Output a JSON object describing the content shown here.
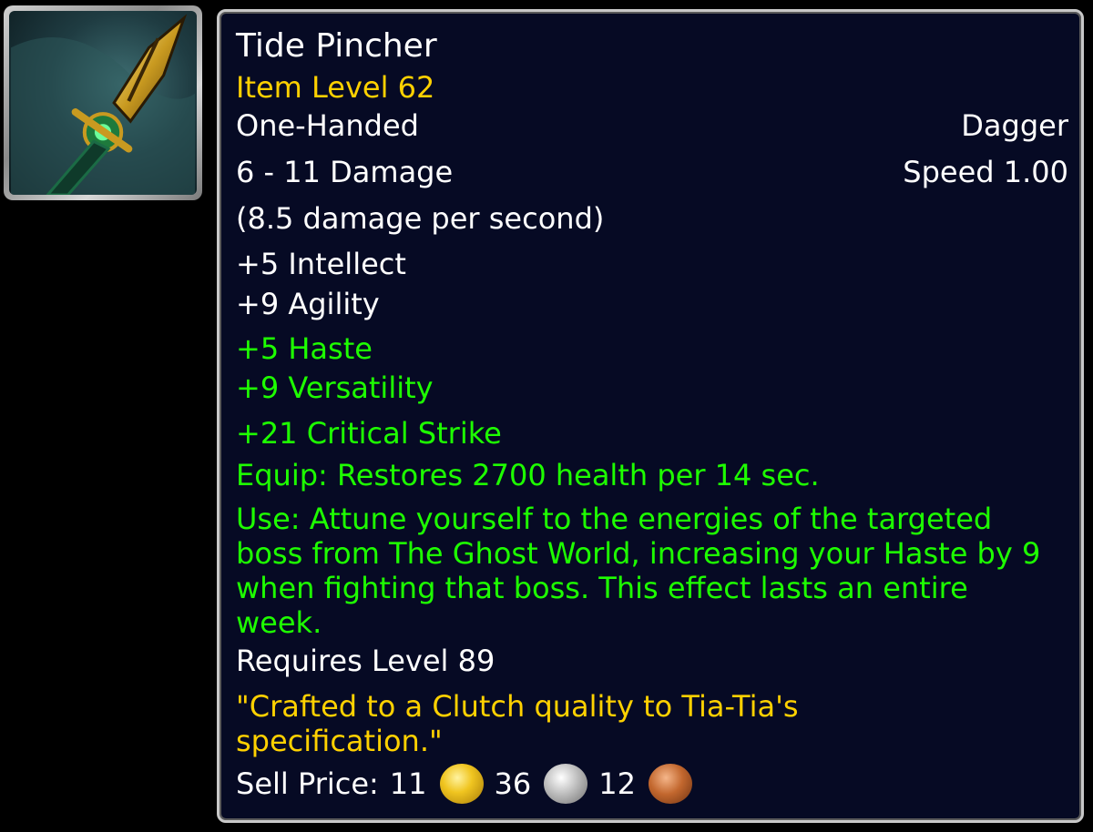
{
  "item": {
    "icon": "dagger-icon",
    "name": "Tide Pincher",
    "item_level": "Item Level 62",
    "slot": "One-Handed",
    "type": "Dagger",
    "damage": "6 - 11 Damage",
    "speed": "Speed 1.00",
    "dps": "(8.5 damage per second)",
    "primary_stats": [
      "+5 Intellect",
      "+9 Agility"
    ],
    "secondary_stats": [
      "+5 Haste",
      "+9 Versatility",
      "+21 Critical Strike"
    ],
    "equip_effect": "Equip: Restores 2700 health per 14 sec.",
    "use_effect": "Use: Attune yourself to the energies of the targeted boss from The Ghost World, increasing your Haste by 9 when fighting that boss. This effect lasts an entire week.",
    "requirement": "Requires Level 89",
    "flavor_text": "\"Crafted to a Clutch quality to Tia-Tia's specification.\"",
    "sell_price": {
      "label": "Sell Price:",
      "gold": "11",
      "silver": "36",
      "copper": "12"
    }
  },
  "colors": {
    "background": "#060a24",
    "white_text": "#ffffff",
    "gold_text": "#ffd100",
    "green_text": "#1eff00",
    "border": "#c8c8c8"
  }
}
